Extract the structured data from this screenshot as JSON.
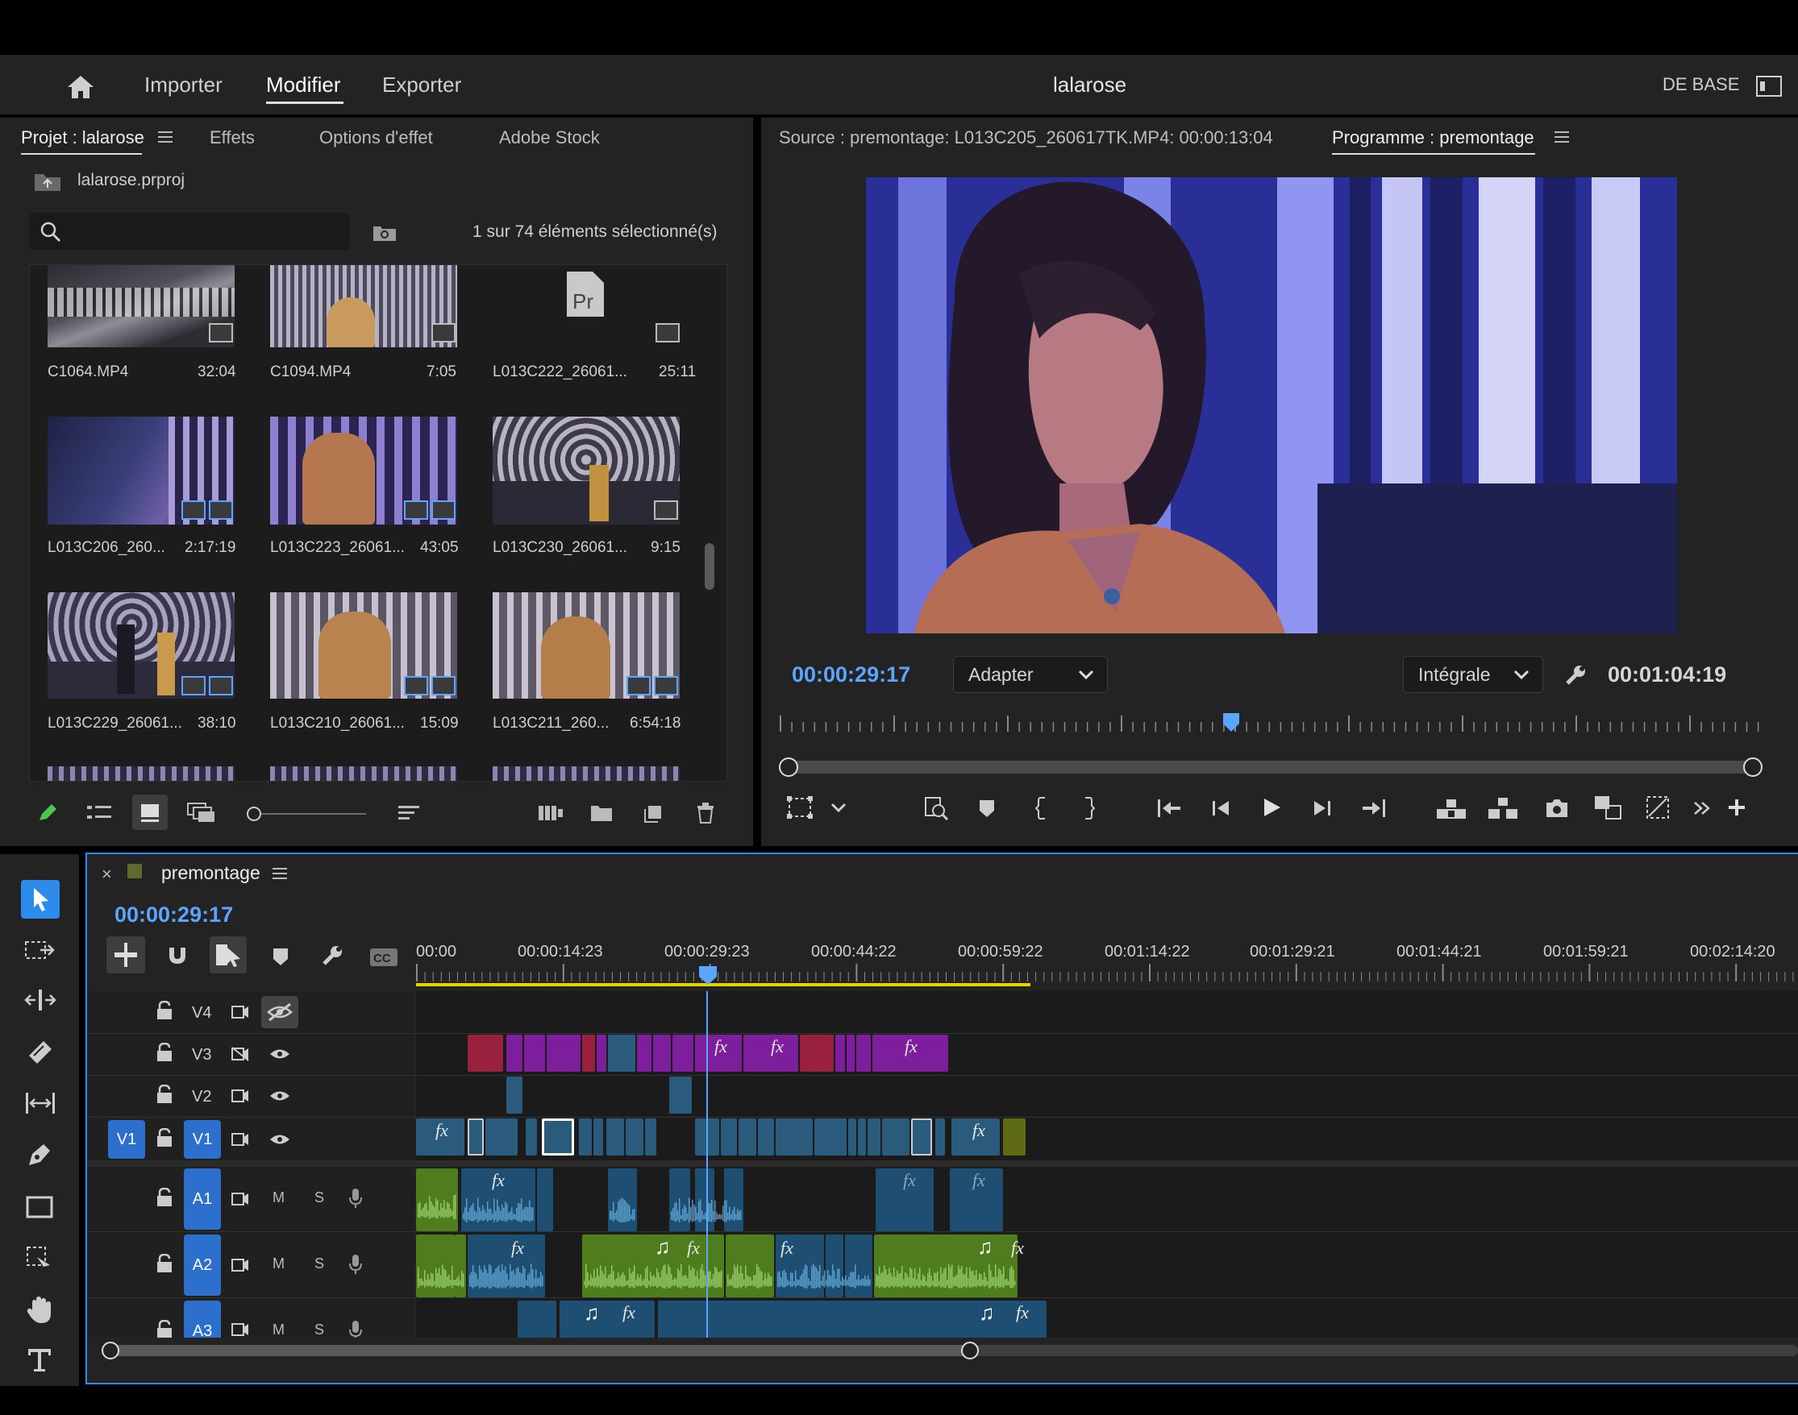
{
  "header": {
    "home_icon": "home-icon",
    "nav": [
      "Importer",
      "Modifier",
      "Exporter"
    ],
    "active_nav": "Modifier",
    "project_title": "lalarose",
    "workspace": "DE BASE"
  },
  "project_panel": {
    "tabs": [
      "Projet : lalarose",
      "Effets",
      "Options d'effet",
      "Adobe Stock"
    ],
    "file_name": "lalarose.prproj",
    "search_placeholder": "",
    "selection_status": "1 sur 74 éléments sélectionné(s)",
    "clips": [
      {
        "name": "C1064.MP4",
        "duration": "32:04"
      },
      {
        "name": "C1094.MP4",
        "duration": "7:05"
      },
      {
        "name": "L013C222_26061...",
        "duration": "25:11"
      },
      {
        "name": "L013C206_260...",
        "duration": "2:17:19"
      },
      {
        "name": "L013C223_26061...",
        "duration": "43:05"
      },
      {
        "name": "L013C230_26061...",
        "duration": "9:15"
      },
      {
        "name": "L013C229_26061...",
        "duration": "38:10"
      },
      {
        "name": "L013C210_26061...",
        "duration": "15:09"
      },
      {
        "name": "L013C211_260...",
        "duration": "6:54:18"
      }
    ]
  },
  "monitor": {
    "source_tab": "Source : premontage: L013C205_260617TK.MP4: 00:00:13:04",
    "program_tab": "Programme : premontage",
    "current_time": "00:00:29:17",
    "zoom": "Adapter",
    "quality": "Intégrale",
    "duration": "00:01:04:19",
    "playhead_fraction": 0.46
  },
  "timeline": {
    "sequence_name": "premontage",
    "current_time": "00:00:29:17",
    "ruler": [
      "00:00",
      "00:00:14:23",
      "00:00:29:23",
      "00:00:44:22",
      "00:00:59:22",
      "00:01:14:22",
      "00:01:29:21",
      "00:01:44:21",
      "00:01:59:21",
      "00:02:14:20"
    ],
    "video_tracks": [
      "V4",
      "V3",
      "V2",
      "V1"
    ],
    "audio_tracks": [
      "A1",
      "A2",
      "A3"
    ],
    "source_patch": "V1",
    "mute_label": "M",
    "solo_label": "S",
    "fx_label": "fx",
    "colors": {
      "accent": "#2d8ceb",
      "video_clip": "#2a5b7c",
      "title_clip": "#7d1f9c",
      "red_clip": "#9a2040",
      "audio_clip": "#1e4f73",
      "green_audio": "#4f7d1d",
      "work_area": "#e3d600"
    }
  }
}
